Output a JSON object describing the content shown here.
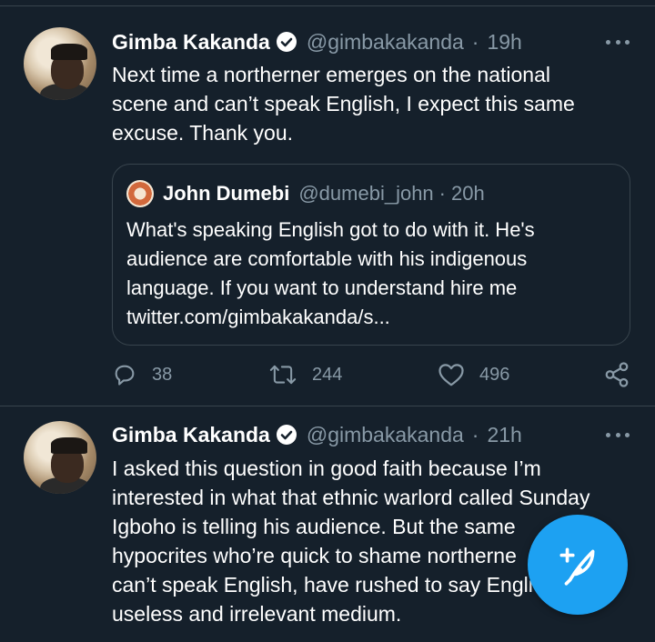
{
  "colors": {
    "background": "#15202b",
    "accent": "#1da1f2",
    "secondary_text": "#8899a6",
    "divider": "#38444d"
  },
  "tweets": [
    {
      "author_name": "Gimba Kakanda",
      "handle": "@gimbakakanda",
      "separator": "·",
      "time": "19h",
      "verified": true,
      "text_lines": [
        "Next time a northerner emerges on the national",
        "scene and can’t speak English, I expect this same",
        "excuse. Thank you."
      ],
      "quote": {
        "author_name": "John Dumebi",
        "handle": "@dumebi_john",
        "separator": "·",
        "time": "20h",
        "text_lines": [
          "What's speaking English got to do with it. He's",
          "audience are comfortable with his indigenous",
          "language. If you want to understand hire me",
          "twitter.com/gimbakakanda/s..."
        ]
      },
      "actions": {
        "replies": "38",
        "retweets": "244",
        "likes": "496"
      }
    },
    {
      "author_name": "Gimba Kakanda",
      "handle": "@gimbakakanda",
      "separator": "·",
      "time": "21h",
      "verified": true,
      "text_lines": [
        "I asked this question in good faith because I’m",
        "interested in what that ethnic warlord called Sunday",
        "Igboho is telling his audience. But the same",
        "hypocrites who’re quick to shame northerne",
        "can’t speak English, have rushed to say Engli",
        "useless and irrelevant medium."
      ]
    }
  ],
  "icons": {
    "reply": "reply-icon",
    "retweet": "retweet-icon",
    "like": "like-icon",
    "share": "share-icon",
    "more": "more-icon",
    "compose": "compose-tweet-icon",
    "verified": "verified-badge-icon"
  }
}
